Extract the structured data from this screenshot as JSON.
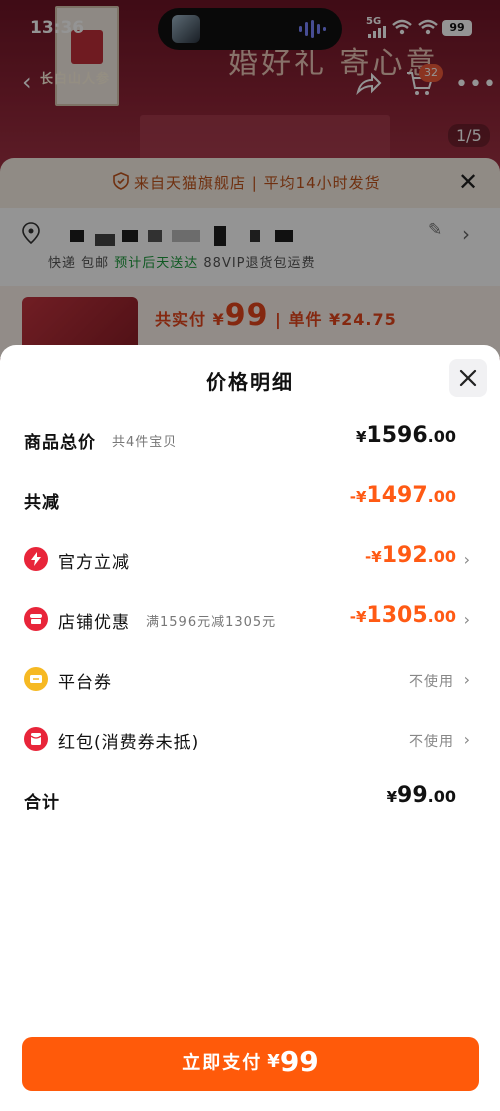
{
  "background": {
    "status_bar": {
      "time": "13:36",
      "network": "5G",
      "battery": "99"
    },
    "shop_name": "长白山人参",
    "hero_title": "婚好礼 寄心意",
    "cart_count": "32",
    "image_pager": "1/5",
    "banner": "来自天猫旗舰店 | 平均14小时发货",
    "express": {
      "prefix": "快递 包邮 ",
      "highlight": "预计后天送达",
      "suffix": " 88VIP退货包运费"
    },
    "pay_summary": {
      "label": "共实付 ¥",
      "amount": "99",
      "unit_label": " | 单件 ¥24.75"
    }
  },
  "modal": {
    "title": "价格明细",
    "rows": [
      {
        "label": "商品总价",
        "sub": "共4件宝贝",
        "yen": "¥",
        "int": "1596",
        "dec": ".00"
      },
      {
        "label": "共减",
        "yen": "-¥",
        "int": "1497",
        "dec": ".00"
      },
      {
        "label": "官方立减",
        "yen": "-¥",
        "int": "192",
        "dec": ".00",
        "icon": "lightning-icon"
      },
      {
        "label": "店铺优惠",
        "sub": "满1596元减1305元",
        "yen": "-¥",
        "int": "1305",
        "dec": ".00",
        "icon": "shop-coupon-icon"
      },
      {
        "label": "平台券",
        "status": "不使用",
        "icon": "ticket-icon"
      },
      {
        "label": "红包(消费券未抵)",
        "status": "不使用",
        "icon": "red-packet-icon"
      },
      {
        "label": "合计",
        "yen": "¥",
        "int": "99",
        "dec": ".00"
      }
    ],
    "pay_button": {
      "label": "立即支付",
      "yen": "¥",
      "amount": "99"
    }
  },
  "colors": {
    "accent": "#ff5a0a",
    "discount": "#ff5a14",
    "icon_red": "#e8253a",
    "icon_yellow": "#f6b923"
  }
}
